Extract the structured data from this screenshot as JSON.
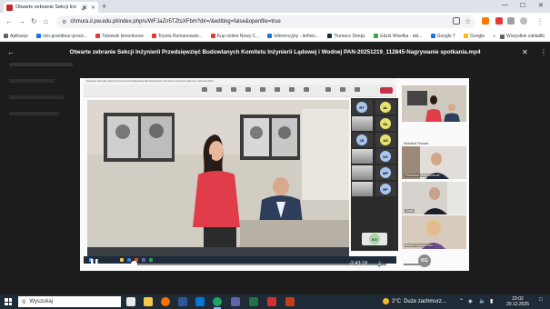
{
  "browser": {
    "tab_title": "Otwarte zebranie Sekcji Inż",
    "new_tab": "+",
    "url": "chmura.il.pw.edu.pl/index.php/s/WFJaZn5TZtsXFbm?dir=/&editing=false&openfile=true",
    "window_controls": [
      "—",
      "☐",
      "✕"
    ]
  },
  "bookmarks": {
    "items": [
      {
        "label": "Aplikacje",
        "color": "#5f6368"
      },
      {
        "label": "cko-grandtour-proce...",
        "color": "#1a73e8"
      },
      {
        "label": "Tatowski kimonkoow",
        "color": "#e53935"
      },
      {
        "label": "Toyota Romanowski...",
        "color": "#e53935"
      },
      {
        "label": "Kup online Nowy C...",
        "color": "#e53935"
      },
      {
        "label": "inferencyjny - definic...",
        "color": "#1a73e8"
      },
      {
        "label": "Tłumacz DeepL",
        "color": "#0f2b46"
      },
      {
        "label": "Edziś Wisełka - akt...",
        "color": "#43a047"
      },
      {
        "label": "Google T",
        "color": "#1a73e8"
      },
      {
        "label": "Google",
        "color": "#fbbc05"
      }
    ],
    "more": "»",
    "all_bookmarks": "Wszystkie zakładki"
  },
  "modal": {
    "title": "Otwarte zebranie Sekcji Inżynierii Przedsięwzięć Budowlanych Komitetu Inżynierii Lądowej i Wodnej PAN-20251219_112845-Nagrywanie spotkania.mp4",
    "back_icon": "←",
    "close_icon": "✕",
    "more_icon": "⋮"
  },
  "inner_meeting": {
    "window_title": "Otwarte zebranie Sekcji Inżynierii Przedsięwzięć Budowlanych Komitetu Inżynierii Lądowej i Wodnej PAN",
    "participants": [
      {
        "initials": "RT",
        "color": "#a9c6ef"
      },
      {
        "initials": "AL",
        "color": "#e7e46f"
      },
      {
        "initials": "GŁ",
        "color": "#e7e46f"
      },
      {
        "initials": "JS",
        "color": "#a9c6ef"
      },
      {
        "initials": "AS",
        "color": "#e7e46f"
      },
      {
        "initials": "KZ",
        "color": "#a9c6ef"
      },
      {
        "initials": "MP",
        "color": "#a9c6ef"
      },
      {
        "initials": "EP",
        "color": "#a9c6ef"
      }
    ],
    "self_initials": "KG"
  },
  "gallery": [
    {
      "name": "Michalski Tomasz"
    },
    {
      "name": "Radosław Marcinkowski"
    },
    {
      "name": "Jacek"
    },
    {
      "name": "Beata Nowogońska"
    }
  ],
  "player": {
    "time_remaining": "-2:43:18",
    "progress": 0.09,
    "volume": 0.45,
    "avatar_initials": "KG"
  },
  "taskbar": {
    "search_placeholder": "Wyszukaj",
    "weather_temp": "2°C",
    "weather_text": "Duże zachmurz...",
    "time": "23:02",
    "date": "20.12.2025"
  }
}
